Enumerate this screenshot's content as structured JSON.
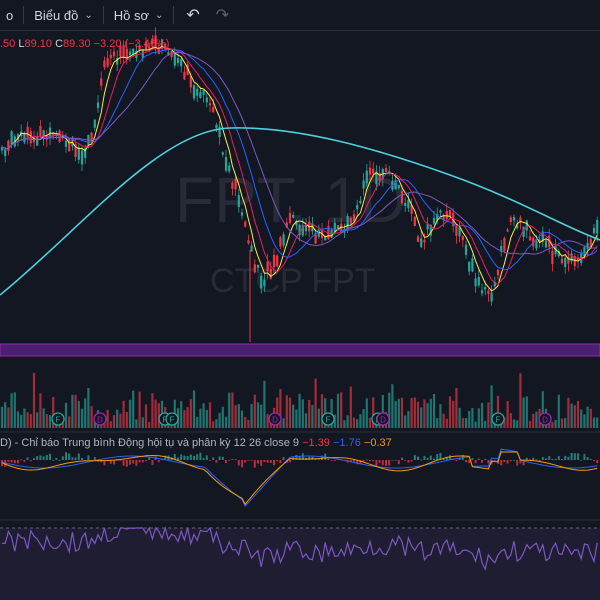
{
  "toolbar": {
    "partial_label": "o",
    "chart_menu_label": "Biểu đồ",
    "profile_menu_label": "Hồ sơ",
    "chevron": "⌄",
    "undo_icon": "↶",
    "redo_icon": "↷"
  },
  "ohlc": {
    "open_tail": ".50",
    "low_prefix": "L",
    "low_value": "89.10",
    "close_prefix": "C",
    "close_value": "89.30",
    "change": "−3.20 (−3.46%)"
  },
  "watermark": {
    "symbol": "FPT, 1D",
    "company": "CTCP FPT"
  },
  "macd": {
    "name": "D) - Chỉ báo Trung bình Động hội tụ và phân kỳ",
    "params": "12 26 close 9",
    "macd_value": "−1.39",
    "signal_value": "−1.76",
    "hist_value": "−0.37"
  },
  "events": {
    "labels": [
      "F",
      "D",
      "F",
      "F",
      "D",
      "F",
      "F",
      "D",
      "F",
      "D"
    ]
  },
  "colors": {
    "background": "#131722",
    "up": "#26a69a",
    "down": "#f23645",
    "ma200": "#4dd0e1",
    "ma_purple": "#7e57c2",
    "ma_blue": "#2962ff",
    "ma_yellow": "#ffeb3b",
    "ma_pink": "#e91e63",
    "rsi_band": "#7e57c2",
    "dividend_purple": "#9c27b0"
  }
}
